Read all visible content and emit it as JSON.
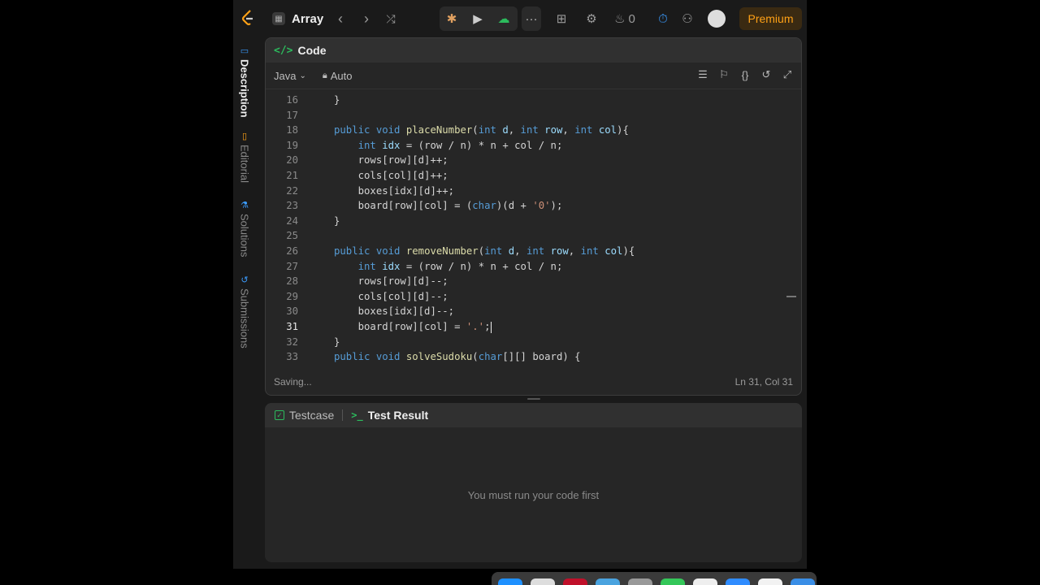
{
  "header": {
    "problem_list_title": "Array",
    "streak_count": "0",
    "premium_label": "Premium"
  },
  "side_tabs": [
    {
      "label": "Description"
    },
    {
      "label": "Editorial"
    },
    {
      "label": "Solutions"
    },
    {
      "label": "Submissions"
    }
  ],
  "code_panel": {
    "title": "Code",
    "language": "Java",
    "mode": "Auto",
    "status_left": "Saving...",
    "status_right": "Ln 31, Col 31"
  },
  "code_lines": [
    {
      "n": "16",
      "text": "}"
    },
    {
      "n": "17",
      "text": ""
    },
    {
      "n": "18",
      "text": "public void placeNumber(int d, int row, int col){"
    },
    {
      "n": "19",
      "text": "    int idx = (row / n) * n + col / n;"
    },
    {
      "n": "20",
      "text": "    rows[row][d]++;"
    },
    {
      "n": "21",
      "text": "    cols[col][d]++;"
    },
    {
      "n": "22",
      "text": "    boxes[idx][d]++;"
    },
    {
      "n": "23",
      "text": "    board[row][col] = (char)(d + '0');"
    },
    {
      "n": "24",
      "text": "}"
    },
    {
      "n": "25",
      "text": ""
    },
    {
      "n": "26",
      "text": "public void removeNumber(int d, int row, int col){"
    },
    {
      "n": "27",
      "text": "    int idx = (row / n) * n + col / n;"
    },
    {
      "n": "28",
      "text": "    rows[row][d]--;"
    },
    {
      "n": "29",
      "text": "    cols[col][d]--;"
    },
    {
      "n": "30",
      "text": "    boxes[idx][d]--;"
    },
    {
      "n": "31",
      "text": "    board[row][col] = '.';"
    },
    {
      "n": "32",
      "text": "}"
    },
    {
      "n": "33",
      "text": "public void solveSudoku(char[][] board) {"
    }
  ],
  "current_line": "31",
  "test_panel": {
    "tab_testcase": "Testcase",
    "tab_result": "Test Result",
    "empty_message": "You must run your code first"
  },
  "colors": {
    "accent_green": "#2cbb5d",
    "premium_orange": "#ffa116",
    "keyword_blue": "#569cd6"
  }
}
